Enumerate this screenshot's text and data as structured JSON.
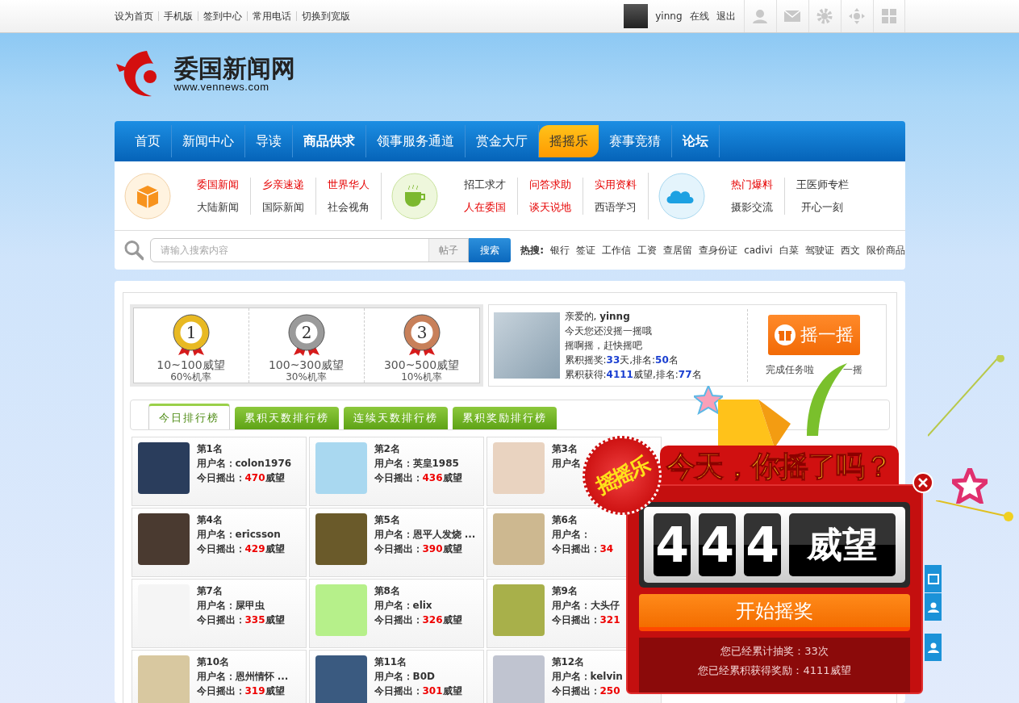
{
  "top_bar": {
    "links": [
      "设为首页",
      "手机版",
      "签到中心",
      "常用电话",
      "切换到宽版"
    ],
    "user": {
      "name": "yinng",
      "status": "在线",
      "logout": "退出"
    }
  },
  "logo": {
    "title": "委国新闻网",
    "url": "www.vennews.com"
  },
  "nav": [
    {
      "label": "首页",
      "bold": false,
      "selected": false
    },
    {
      "label": "新闻中心",
      "bold": false,
      "selected": false
    },
    {
      "label": "导读",
      "bold": false,
      "selected": false
    },
    {
      "label": "商品供求",
      "bold": true,
      "selected": false
    },
    {
      "label": "领事服务通道",
      "bold": false,
      "selected": false
    },
    {
      "label": "赏金大厅",
      "bold": false,
      "selected": false
    },
    {
      "label": "摇摇乐",
      "bold": false,
      "selected": true
    },
    {
      "label": "赛事竞猜",
      "bold": false,
      "selected": false
    },
    {
      "label": "论坛",
      "bold": true,
      "selected": false
    }
  ],
  "sub_nav": [
    {
      "columns": [
        [
          {
            "label": "委国新闻",
            "hot": true
          },
          {
            "label": "大陆新闻",
            "hot": false
          }
        ],
        [
          {
            "label": "乡亲速递",
            "hot": true
          },
          {
            "label": "国际新闻",
            "hot": false
          }
        ],
        [
          {
            "label": "世界华人",
            "hot": true
          },
          {
            "label": "社会视角",
            "hot": false
          }
        ]
      ]
    },
    {
      "columns": [
        [
          {
            "label": "招工求才",
            "hot": false
          },
          {
            "label": "人在委国",
            "hot": true
          }
        ],
        [
          {
            "label": "问答求助",
            "hot": true
          },
          {
            "label": "谈天说地",
            "hot": true
          }
        ],
        [
          {
            "label": "实用资料",
            "hot": true
          },
          {
            "label": "西语学习",
            "hot": false
          }
        ]
      ]
    },
    {
      "columns": [
        [
          {
            "label": "热门爆料",
            "hot": true
          },
          {
            "label": "摄影交流",
            "hot": false
          }
        ],
        [
          {
            "label": "王医师专栏",
            "hot": false
          },
          {
            "label": "开心一刻",
            "hot": false
          }
        ]
      ]
    }
  ],
  "search": {
    "placeholder": "请输入搜索内容",
    "scope": "帖子",
    "button": "搜索",
    "hot_label": "热搜:",
    "hot": [
      "银行",
      "签证",
      "工作信",
      "工资",
      "查居留",
      "查身份证",
      "cadivi",
      "白菜",
      "驾驶证",
      "西文",
      "限价商品"
    ]
  },
  "prize_tiers": [
    {
      "medal": "1",
      "range": "10~100威望",
      "chance": "60%机率",
      "color": "#e8b923"
    },
    {
      "medal": "2",
      "range": "100~300威望",
      "chance": "30%机率",
      "color": "#9a9a9a"
    },
    {
      "medal": "3",
      "range": "300~500威望",
      "chance": "10%机率",
      "color": "#c8805a"
    }
  ],
  "greeting": {
    "lines": [
      "亲爱的, **yinng**",
      "今天您还没摇一摇哦",
      "摇啊摇，赶快摇吧",
      "累积摇奖:**33**天,排名:**50**名",
      "累积获得:**4111**威望,排名:**77**名"
    ],
    "shake_button": "摇一摇",
    "task_note": [
      "完成任务啦",
      "一摇"
    ]
  },
  "rank_tabs": [
    {
      "label": "今日排行榜",
      "selected": true
    },
    {
      "label": "累积天数排行榜",
      "selected": false
    },
    {
      "label": "连续天数排行榜",
      "selected": false
    },
    {
      "label": "累积奖励排行榜",
      "selected": false
    }
  ],
  "ranks": [
    {
      "rank": "第1名",
      "user": "用户名：colon1976",
      "score_label": "今日摇出：",
      "score": "470",
      "unit": "威望"
    },
    {
      "rank": "第2名",
      "user": "用户名：英皇1985",
      "score_label": "今日摇出：",
      "score": "436",
      "unit": "威望"
    },
    {
      "rank": "第3名",
      "user": "用户名"
    },
    {
      "rank": "第4名",
      "user": "用户名：ericsson",
      "score_label": "今日摇出：",
      "score": "429",
      "unit": "威望"
    },
    {
      "rank": "第5名",
      "user": "用户名：恩平人发烧 ...",
      "score_label": "今日摇出：",
      "score": "390",
      "unit": "威望"
    },
    {
      "rank": "第6名",
      "user": "用户名：",
      "score_label": "今日摇出：",
      "score": "34"
    },
    {
      "rank": "第7名",
      "user": "用户名：屎甲虫",
      "score_label": "今日摇出：",
      "score": "335",
      "unit": "威望"
    },
    {
      "rank": "第8名",
      "user": "用户名：elix",
      "score_label": "今日摇出：",
      "score": "326",
      "unit": "威望"
    },
    {
      "rank": "第9名",
      "user": "用户名：大头仔",
      "score_label": "今日摇出：",
      "score": "321"
    },
    {
      "rank": "第10名",
      "user": "用户名：恩州情怀 ...",
      "score_label": "今日摇出：",
      "score": "319",
      "unit": "威望"
    },
    {
      "rank": "第11名",
      "user": "用户名：B0D",
      "score_label": "今日摇出：",
      "score": "301",
      "unit": "威望"
    },
    {
      "rank": "第12名",
      "user": "用户名：kelvin",
      "score_label": "今日摇出：",
      "score": "250"
    }
  ],
  "popup": {
    "badge": "摇摇乐",
    "banner": "今天，你摇了吗？",
    "digits": [
      "4",
      "4",
      "4"
    ],
    "unit": "威望",
    "button": "开始摇奖",
    "stats": [
      "您已经累计抽奖：33次",
      "您已经累积获得奖励：4111威望"
    ]
  }
}
